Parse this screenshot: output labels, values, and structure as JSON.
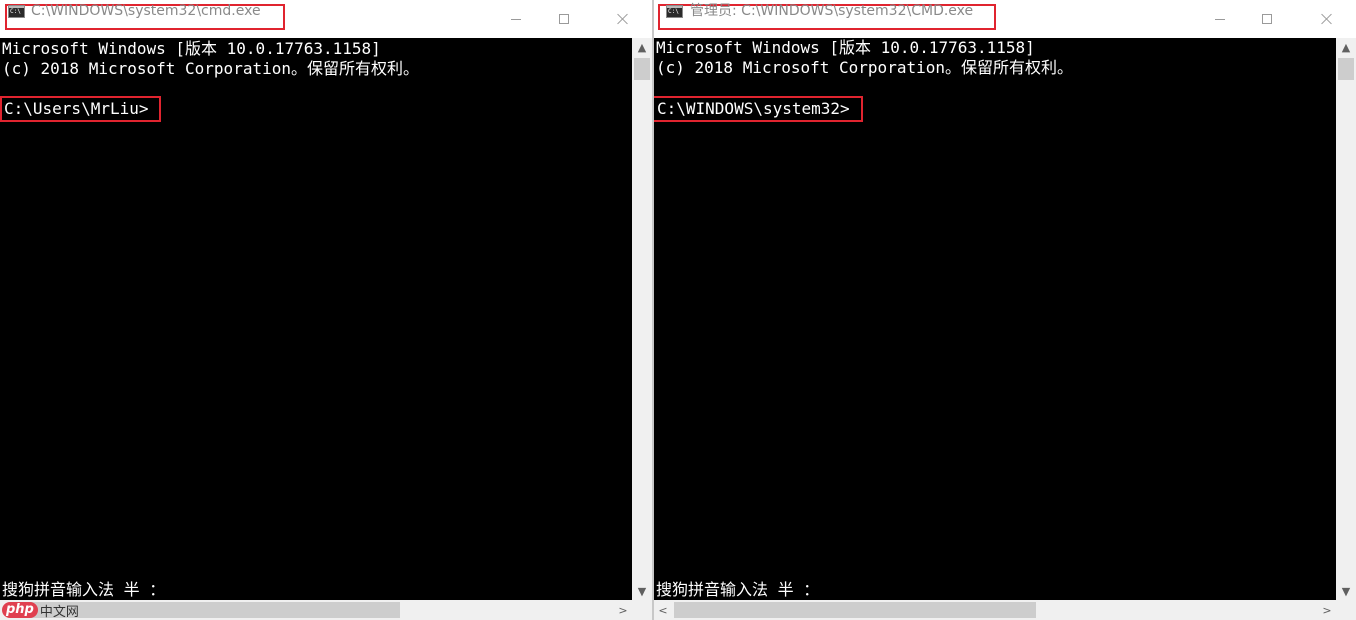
{
  "windows": [
    {
      "title": "C:\\WINDOWS\\system32\\cmd.exe",
      "lines": [
        "Microsoft Windows [版本 10.0.17763.1158]",
        "(c) 2018 Microsoft Corporation。保留所有权利。"
      ],
      "prompt": "C:\\Users\\MrLiu>",
      "ime_status": "搜狗拼音输入法 半 ："
    },
    {
      "title": "管理员: C:\\WINDOWS\\system32\\CMD.exe",
      "lines": [
        "Microsoft Windows [版本 10.0.17763.1158]",
        "(c) 2018 Microsoft Corporation。保留所有权利。"
      ],
      "prompt": "C:\\WINDOWS\\system32>",
      "ime_status": "搜狗拼音输入法 半 ："
    }
  ],
  "controls": {
    "minimize": "minimize-icon",
    "maximize": "maximize-icon",
    "close": "close-icon"
  },
  "scroll_arrows": {
    "up": "▲",
    "down": "▼",
    "left": "<",
    "right": ">"
  },
  "watermark": {
    "php": "php",
    "cn": "中文网"
  },
  "colors": {
    "console_bg": "#000000",
    "console_text": "#ffffff",
    "highlight_border": "#e0242f",
    "title_text": "#8a8a8a"
  }
}
